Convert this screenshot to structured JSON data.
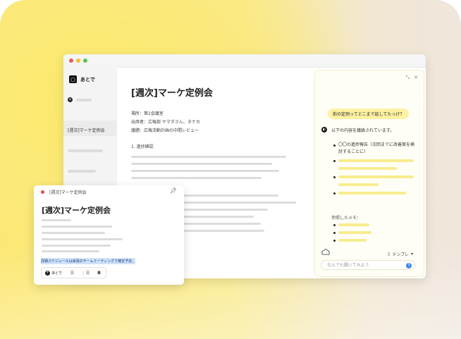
{
  "app": {
    "name": "あとで"
  },
  "sidebar": {
    "selected_item": "[週次]マーケ定例会"
  },
  "document": {
    "title": "[週次]マーケ定例会",
    "location": "場所：第2会議室",
    "attendees": "出席者：広報部 ヤマダさん、タナカ",
    "agenda": "議題：広報活動計画の中間レビュー",
    "section": "1. 進捗確認"
  },
  "chat": {
    "question": "前の定例ってどこまで話してたっけ？",
    "answer_intro": "以下の内容を議論されています。",
    "item1": "〇〇の進捗報告（次回までに改善案を検討することに）",
    "memo_label": "参照したメモ：",
    "template_label": "テンプレ",
    "input_placeholder": "なんでも聞いてみよう"
  },
  "note": {
    "header_title": "[週次]マーケ定例会",
    "title": "[週次]マーケ定例会",
    "highlighted_text": "詳細スケジュールは来週のチームミーティングで確定予定。",
    "toolbar": {
      "atode_label": "あとで",
      "bold_label": "B"
    }
  },
  "icons": [
    "close-icon",
    "minimize-icon",
    "pin-icon",
    "send-icon",
    "mascot-icon",
    "book-icon",
    "list-icon",
    "numbered-list-icon"
  ],
  "colors": {
    "accent_yellow": "#fdf1a2",
    "send_blue": "#3d8bf0",
    "selection_blue": "#cfe2fb"
  }
}
